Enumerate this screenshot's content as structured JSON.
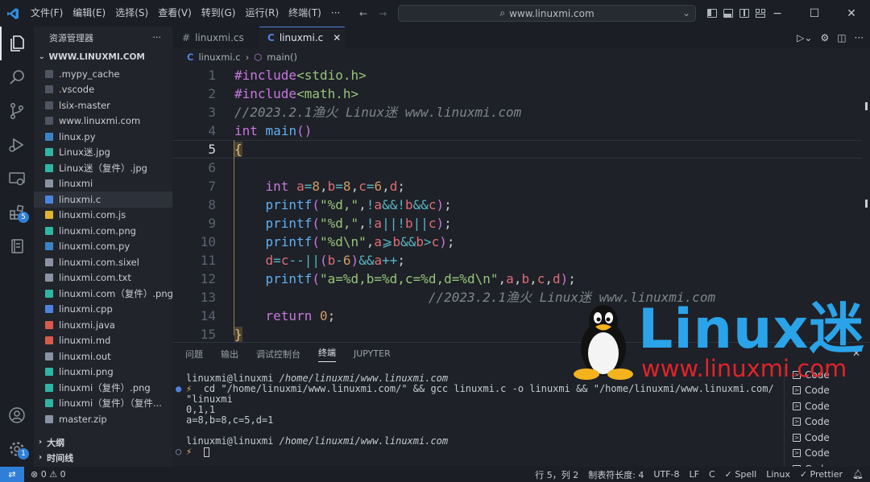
{
  "menu": [
    "文件(F)",
    "编辑(E)",
    "选择(S)",
    "查看(V)",
    "转到(G)",
    "运行(R)",
    "终端(T)",
    "···"
  ],
  "search": {
    "text": "www.linuxmi.com"
  },
  "sidebar": {
    "title": "资源管理器",
    "root": "WWW.LINUXMI.COM",
    "files": [
      {
        "name": ".mypy_cache",
        "icon": "folder-icon",
        "color": "#4f5663"
      },
      {
        "name": ".vscode",
        "icon": "folder-icon",
        "color": "#4f5663"
      },
      {
        "name": "lsix-master",
        "icon": "folder-icon",
        "color": "#4f5663"
      },
      {
        "name": "www.linuxmi.com",
        "icon": "folder-icon",
        "color": "#4f5663"
      },
      {
        "name": "linux.py",
        "icon": "python-icon",
        "color": "#3b82c4"
      },
      {
        "name": "Linux迷.jpg",
        "icon": "image-icon",
        "color": "#2fb5a3"
      },
      {
        "name": "Linux迷（复件）.jpg",
        "icon": "image-icon",
        "color": "#2fb5a3"
      },
      {
        "name": "linuxmi",
        "icon": "file-icon",
        "color": "#8a93a3"
      },
      {
        "name": "linuxmi.c",
        "icon": "c-icon",
        "color": "#4c83e0",
        "selected": true
      },
      {
        "name": "linuxmi.com.js",
        "icon": "js-icon",
        "color": "#e0b531"
      },
      {
        "name": "linuxmi.com.png",
        "icon": "image-icon",
        "color": "#2fb5a3"
      },
      {
        "name": "linuxmi.com.py",
        "icon": "python-icon",
        "color": "#3b82c4"
      },
      {
        "name": "linuxmi.com.sixel",
        "icon": "file-icon",
        "color": "#8a93a3"
      },
      {
        "name": "linuxmi.com.txt",
        "icon": "file-icon",
        "color": "#8a93a3"
      },
      {
        "name": "linuxmi.com（复件）.png",
        "icon": "image-icon",
        "color": "#2fb5a3"
      },
      {
        "name": "linuxmi.cpp",
        "icon": "cpp-icon",
        "color": "#4c83e0"
      },
      {
        "name": "linuxmi.java",
        "icon": "java-icon",
        "color": "#d95a4a"
      },
      {
        "name": "linuxmi.md",
        "icon": "markdown-icon",
        "color": "#d95a4a"
      },
      {
        "name": "linuxmi.out",
        "icon": "file-icon",
        "color": "#8a93a3"
      },
      {
        "name": "linuxmi.png",
        "icon": "image-icon",
        "color": "#2fb5a3"
      },
      {
        "name": "linuxmi（复件）.png",
        "icon": "image-icon",
        "color": "#2fb5a3"
      },
      {
        "name": "linuxmi（复件）（复件...",
        "icon": "image-icon",
        "color": "#2fb5a3"
      },
      {
        "name": "master.zip",
        "icon": "zip-icon",
        "color": "#8a93a3"
      }
    ],
    "sections": [
      "大纲",
      "时间线"
    ]
  },
  "tabs": [
    {
      "label": "linuxmi.cs",
      "icon": "#"
    },
    {
      "label": "linuxmi.c",
      "icon": "C"
    }
  ],
  "breadcrumb": {
    "file": "linuxmi.c",
    "symbol": "main()"
  },
  "editor": {
    "current_line": "5",
    "line_numbers": [
      "1",
      "2",
      "3",
      "4",
      "5",
      "6",
      "7",
      "8",
      "9",
      "10",
      "11",
      "12",
      "13",
      "14",
      "15"
    ]
  },
  "panel": {
    "tabs": [
      "问题",
      "输出",
      "调试控制台",
      "终端",
      "JUPYTER"
    ],
    "active_tab": "终端",
    "terminal": {
      "prompt1_user": "linuxmi@linuxmi",
      "prompt1_path": "/home/linuxmi/www.linuxmi.com",
      "cmd_line1": "cd \"/home/linuxmi/www.linuxmi.com/\" && gcc linuxmi.c -o linuxmi && \"/home/linuxmi/www.linuxmi.com/",
      "cmd_line2": "\"linuxmi",
      "out1": "0,1,1",
      "out2": "a=8,b=8,c=5,d=1",
      "prompt2_user": "linuxmi@linuxmi",
      "prompt2_path": "/home/linuxmi/www.linuxmi.com"
    },
    "terminal_list": [
      "Code",
      "Code",
      "Code",
      "Code",
      "Code",
      "Code",
      "Code"
    ]
  },
  "statusbar": {
    "errors": "⊗ 0 ⚠ 0",
    "position": "行 5，列 2",
    "tab_size": "制表符长度: 4",
    "encoding": "UTF-8",
    "eol": "LF",
    "language": "C",
    "spell": "✓ Spell",
    "os": "Linux",
    "prettier": "✓ Prettier"
  },
  "watermark": {
    "brand": "Linux迷",
    "url": "www.linuxmi.com"
  },
  "colors": {
    "accent": "#2f7fd8",
    "keyword": "#c678dd",
    "string": "#98c379",
    "comment": "#7f848e",
    "function": "#61afef",
    "variable": "#e06c75",
    "number": "#d19a66"
  }
}
